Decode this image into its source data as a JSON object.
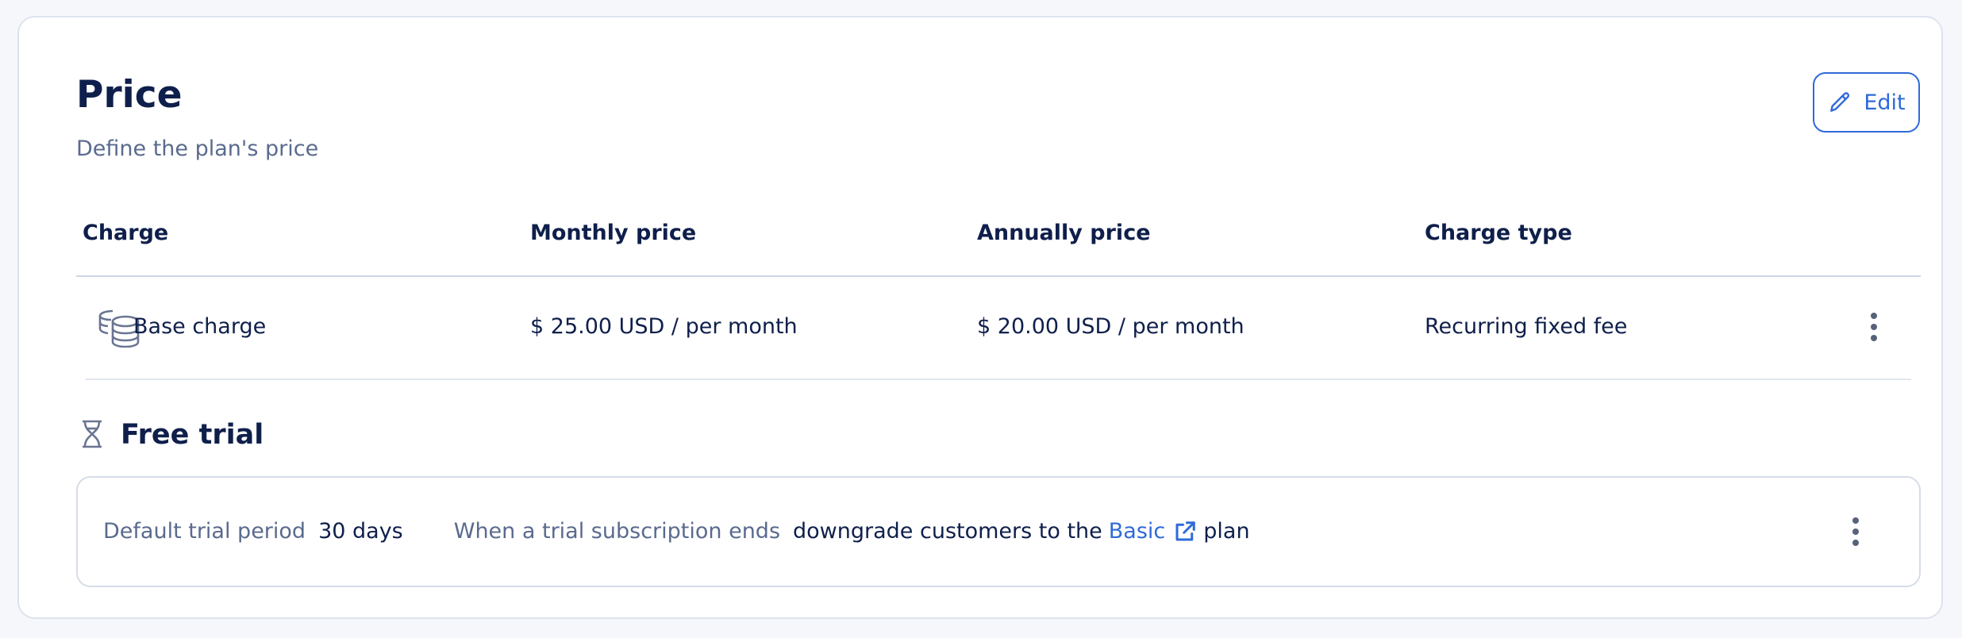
{
  "header": {
    "title": "Price",
    "subtitle": "Define the plan's price",
    "edit_label": "Edit"
  },
  "table": {
    "columns": [
      "Charge",
      "Monthly price",
      "Annually price",
      "Charge type"
    ],
    "rows": [
      {
        "charge": "Base charge",
        "monthly": "$ 25.00 USD / per month",
        "annually": "$ 20.00 USD / per month",
        "type": "Recurring fixed fee"
      }
    ]
  },
  "free_trial": {
    "title": "Free trial",
    "period_label": "Default trial period",
    "period_value": "30 days",
    "end_label": "When a trial subscription ends",
    "end_text_before": "downgrade customers to the",
    "plan_link": "Basic",
    "end_text_after": "plan"
  },
  "icons": {
    "edit": "pencil-icon",
    "charge": "coins-stack-icon",
    "trial": "hourglass-icon",
    "link": "external-link-icon",
    "menu": "kebab-menu-icon"
  },
  "colors": {
    "accent": "#2f6ad9",
    "text": "#0f1f4b",
    "muted": "#5a6a8e",
    "border": "#dde3ee"
  }
}
